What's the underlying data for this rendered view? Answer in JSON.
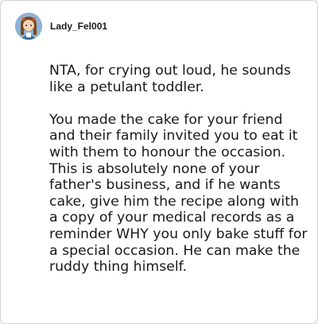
{
  "comment": {
    "username": "Lady_Fel001",
    "paragraphs": [
      "NTA, for crying out loud, he sounds like a petulant toddler.",
      "You made the cake for your friend and their family invited you to eat it with them to honour the occasion. This is absolutely none of your father's business, and if he wants cake, give him the recipe along with a copy of your medical records as a reminder WHY you only bake stuff for a special occasion. He can make the ruddy thing himself."
    ]
  },
  "avatar": {
    "icon": "user-avatar-icon",
    "background": "#7aa6cf"
  },
  "colors": {
    "text": "#1a1a1b",
    "card_background": "#ffffff",
    "page_background": "#f1f1f1",
    "border": "#d4d4d4"
  }
}
